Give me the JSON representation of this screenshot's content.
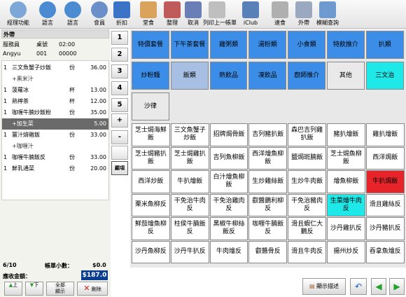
{
  "toolbar": [
    {
      "label": "經理功能",
      "icon": "manager-icon",
      "color": "#7da7d6"
    },
    {
      "label": "語言",
      "icon": "globe-icon",
      "color": "#4a8bd1"
    },
    {
      "label": "語言",
      "icon": "globe-icon",
      "color": "#4a8bd1"
    },
    {
      "label": "會員",
      "icon": "members-icon",
      "color": "#6b8fc9"
    },
    {
      "label": "折扣",
      "icon": "percent-icon",
      "color": "#3b74c6"
    },
    {
      "label": "堂食",
      "icon": "dine-in-icon",
      "color": "#d9a35c"
    },
    {
      "label": "整理",
      "icon": "organize-icon",
      "color": "#c05b5b"
    },
    {
      "label": "取消",
      "icon": "cancel-icon",
      "color": "#6a7fb5"
    },
    {
      "label": "列印上一帳單",
      "icon": "print-icon",
      "color": "#bfbfbf"
    },
    {
      "label": "iClub",
      "icon": "iclub-icon",
      "color": "#5a80b8"
    },
    {
      "label": "速食",
      "icon": "fastfood-icon",
      "color": "#b0b0b0"
    },
    {
      "label": "外帶",
      "icon": "takeaway-icon",
      "color": "#9aa8c0"
    },
    {
      "label": "模糊查詢",
      "icon": "search-icon",
      "color": "#6e9ad0"
    }
  ],
  "order": {
    "mode": "外帶",
    "header_labels": {
      "server": "服務員",
      "table": "桌號",
      "time": "02:00"
    },
    "header_values": {
      "server": "Angyu",
      "table": "001",
      "check": "00000"
    },
    "items": [
      {
        "qty": "1",
        "name": "三文魚蟹子炒飯",
        "unit": "份",
        "price": "36.00",
        "type": "item"
      },
      {
        "qty": "",
        "name": "+黑米汁",
        "unit": "",
        "price": "",
        "type": "sub"
      },
      {
        "qty": "1",
        "name": "菠蘿冰",
        "unit": "杯",
        "price": "13.00",
        "type": "item"
      },
      {
        "qty": "1",
        "name": "熱檸茶",
        "unit": "杯",
        "price": "12.00",
        "type": "item"
      },
      {
        "qty": "1",
        "name": "咖喱牛腩炒飯粉",
        "unit": "份",
        "price": "35.00",
        "type": "item"
      },
      {
        "qty": "",
        "name": "+加生菜",
        "unit": "",
        "price": "5.00",
        "type": "sel"
      },
      {
        "qty": "1",
        "name": "薑汁燴雞飯",
        "unit": "份",
        "price": "33.00",
        "type": "item"
      },
      {
        "qty": "",
        "name": "+咖喱汁",
        "unit": "",
        "price": "",
        "type": "sub"
      },
      {
        "qty": "1",
        "name": "咖喱牛腩飯反",
        "unit": "份",
        "price": "33.00",
        "type": "item"
      },
      {
        "qty": "1",
        "name": "鮮乳通菜",
        "unit": "份",
        "price": "20.00",
        "type": "item"
      }
    ],
    "count": "6/10",
    "subtotal_label": "帳單小數：",
    "subtotal": "$0.0",
    "total_label": "應收金額：",
    "total": "$187.0",
    "buttons": {
      "up": "上",
      "down": "下",
      "all": "全部\n顯示",
      "delete": "刪除"
    }
  },
  "numpad": [
    "1",
    "2",
    "3",
    "4",
    "5",
    "+",
    "-",
    "",
    "顯項"
  ],
  "categories": [
    [
      "特價套餐",
      "下午茶套餐",
      "雞粥類",
      "湯粉類",
      "小食類",
      "特飲推介",
      "扒類"
    ],
    [
      "炒粉麵",
      "飯類",
      "熱飲品",
      "凍飲品",
      "廚師推介",
      "其他",
      "三文治"
    ],
    [
      "沙律"
    ]
  ],
  "items": [
    [
      "芝士焗海鮮飯",
      "三文魚蟹子炒飯",
      "招牌焗骨飯",
      "吉列豬扒飯",
      "森巴吉列雞扒飯",
      "豬扒燴飯",
      "雞扒燴飯"
    ],
    [
      "芝士焗豬扒飯",
      "芝士焗雞扒飯",
      "吉列魚柳飯",
      "西洋燴魚柳飯",
      "鹽焗斑腩飯",
      "芝士焗魚柳飯",
      "西洋焗飯"
    ],
    [
      "西洋炒飯",
      "牛扒燴飯",
      "白汁燴魚柳飯",
      "生炒雞絲飯",
      "生炒牛肉飯",
      "燴魚柳飯",
      "牛扒焗飯"
    ],
    [
      "栗米魚柳反",
      "干免治牛肉反",
      "干免治雞肉反",
      "叡醬鵝利柳反",
      "干免治豬肉反",
      "生菜燴牛肉反",
      "滑且雞絲反"
    ],
    [
      "鮮茄燴魚柳反",
      "柱侯牛腩飯反",
      "黑椒牛柳絲飯反",
      "咖喱牛腩飯反",
      "滑且蝦仁大鵝反",
      "沙丹雞扒反",
      "沙丹豬扒反"
    ],
    [
      "沙丹魚柳反",
      "沙丹牛扒反",
      "牛肉燴反",
      "叡醬骨反",
      "滑且牛肉反",
      "揚州炒反",
      "吞拿魚燴反"
    ]
  ],
  "bottom": {
    "display_label": "顯示描述"
  },
  "colors": {
    "category": "#3b8de8",
    "active": "#a6bfe2",
    "cyan": "#1fe8e8",
    "red": "#e8242b",
    "total": "#0a3d8f"
  }
}
